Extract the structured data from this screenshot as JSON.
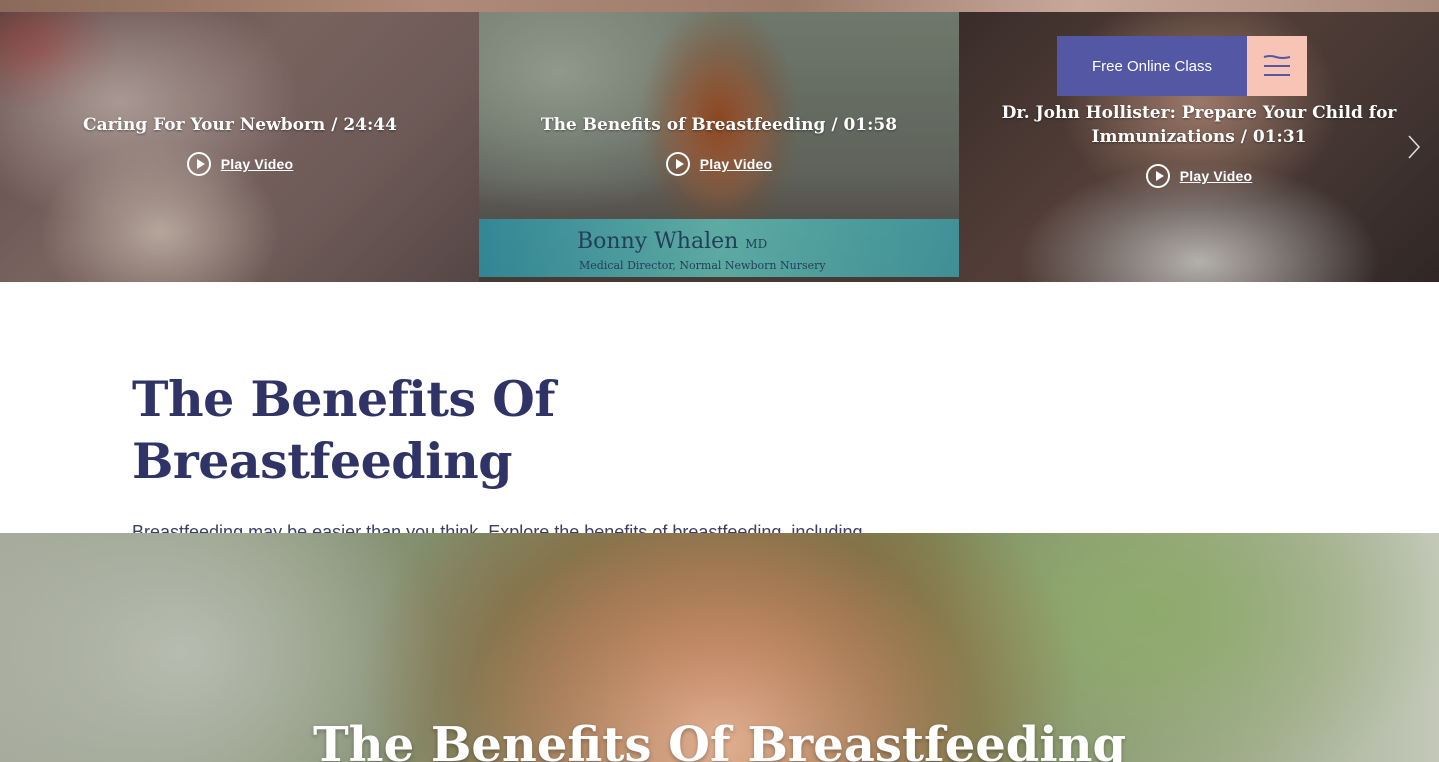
{
  "carousel": {
    "slides": [
      {
        "caption": "Caring For Your Newborn / 24:44",
        "play_label": "Play Video"
      },
      {
        "caption": "The Benefits of Breastfeeding / 01:58",
        "play_label": "Play Video",
        "lower_third_name": "Bonny Whalen",
        "lower_third_suffix": "MD",
        "lower_third_role": "Medical Director, Normal Newborn Nursery"
      },
      {
        "caption": "Dr. John Hollister: Prepare Your Child for Immunizations / 01:31",
        "play_label": "Play Video"
      }
    ]
  },
  "header": {
    "cta_label": "Free Online Class",
    "menu_icon": "menu-icon"
  },
  "intro": {
    "title": "The Benefits Of Breastfeeding",
    "body": "Breastfeeding may be easier than you think. Explore the benefits of breastfeeding, including lower rates of childhood illnesses and infections, and why your baby is not the only beneficiary."
  },
  "hero": {
    "title": "The Benefits Of Breastfeeding"
  },
  "colors": {
    "brand": "#2f3366",
    "cta": "#5457a4",
    "menu_bg": "#f7c4b6"
  }
}
